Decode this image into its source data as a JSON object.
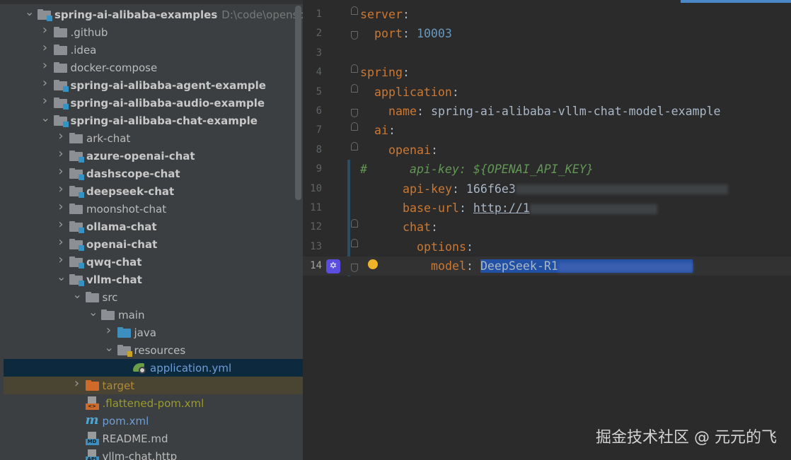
{
  "project_tree": {
    "root_path": "D:\\code\\opensource\\",
    "items": [
      {
        "label": "spring-ai-alibaba-examples",
        "level": 0,
        "expand": "open",
        "icon": "module-folder",
        "bold": true
      },
      {
        "label": ".github",
        "level": 1,
        "expand": "closed",
        "icon": "folder"
      },
      {
        "label": ".idea",
        "level": 1,
        "expand": "closed",
        "icon": "folder"
      },
      {
        "label": "docker-compose",
        "level": 1,
        "expand": "closed",
        "icon": "folder"
      },
      {
        "label": "spring-ai-alibaba-agent-example",
        "level": 1,
        "expand": "closed",
        "icon": "module-folder",
        "bold": true
      },
      {
        "label": "spring-ai-alibaba-audio-example",
        "level": 1,
        "expand": "closed",
        "icon": "module-folder",
        "bold": true
      },
      {
        "label": "spring-ai-alibaba-chat-example",
        "level": 1,
        "expand": "open",
        "icon": "module-folder",
        "bold": true
      },
      {
        "label": "ark-chat",
        "level": 2,
        "expand": "closed",
        "icon": "folder"
      },
      {
        "label": "azure-openai-chat",
        "level": 2,
        "expand": "closed",
        "icon": "module-folder",
        "bold": true
      },
      {
        "label": "dashscope-chat",
        "level": 2,
        "expand": "closed",
        "icon": "module-folder",
        "bold": true
      },
      {
        "label": "deepseek-chat",
        "level": 2,
        "expand": "closed",
        "icon": "module-folder",
        "bold": true
      },
      {
        "label": "moonshot-chat",
        "level": 2,
        "expand": "closed",
        "icon": "folder"
      },
      {
        "label": "ollama-chat",
        "level": 2,
        "expand": "closed",
        "icon": "module-folder",
        "bold": true
      },
      {
        "label": "openai-chat",
        "level": 2,
        "expand": "closed",
        "icon": "module-folder",
        "bold": true
      },
      {
        "label": "qwq-chat",
        "level": 2,
        "expand": "closed",
        "icon": "module-folder",
        "bold": true
      },
      {
        "label": "vllm-chat",
        "level": 2,
        "expand": "open",
        "icon": "module-folder",
        "bold": true
      },
      {
        "label": "src",
        "level": 3,
        "expand": "open",
        "icon": "folder"
      },
      {
        "label": "main",
        "level": 4,
        "expand": "open",
        "icon": "folder"
      },
      {
        "label": "java",
        "level": 5,
        "expand": "closed",
        "icon": "source-folder"
      },
      {
        "label": "resources",
        "level": 5,
        "expand": "open",
        "icon": "resources-folder"
      },
      {
        "label": "application.yml",
        "level": 6,
        "expand": "none",
        "icon": "spring-yml",
        "state": "selected",
        "color": "#6e9ed6"
      },
      {
        "label": "target",
        "level": 3,
        "expand": "closed",
        "icon": "excluded-folder",
        "state": "excluded",
        "color": "#b08a3a"
      },
      {
        "label": ".flattened-pom.xml",
        "level": 3,
        "expand": "none",
        "icon": "xml-file",
        "color": "#9a9a2e"
      },
      {
        "label": "pom.xml",
        "level": 3,
        "expand": "none",
        "icon": "maven-file",
        "color": "#6e9ed6"
      },
      {
        "label": "README.md",
        "level": 3,
        "expand": "none",
        "icon": "md-file"
      },
      {
        "label": "vllm-chat.http",
        "level": 3,
        "expand": "none",
        "icon": "http-file"
      }
    ]
  },
  "editor": {
    "lines": [
      {
        "num": "1",
        "indent": 0,
        "tokens": [
          [
            "k",
            "server"
          ],
          [
            "",
            ""
          ],
          [
            "",
            ":"
          ]
        ],
        "fold": "up"
      },
      {
        "num": "2",
        "indent": 1,
        "tokens": [
          [
            "k",
            "port"
          ],
          [
            "",
            ": "
          ],
          [
            "n",
            "10003"
          ]
        ],
        "fold": "down"
      },
      {
        "num": "3",
        "indent": 0,
        "tokens": []
      },
      {
        "num": "4",
        "indent": 0,
        "tokens": [
          [
            "k",
            "spring"
          ],
          [
            "",
            ":"
          ]
        ],
        "fold": "up"
      },
      {
        "num": "5",
        "indent": 1,
        "tokens": [
          [
            "k",
            "application"
          ],
          [
            "",
            ":"
          ]
        ],
        "fold": "up"
      },
      {
        "num": "6",
        "indent": 2,
        "tokens": [
          [
            "k",
            "name"
          ],
          [
            "",
            ": spring-ai-alibaba-vllm-chat-model-example"
          ]
        ],
        "fold": "down"
      },
      {
        "num": "7",
        "indent": 1,
        "tokens": [
          [
            "k",
            "ai"
          ],
          [
            "",
            ":"
          ]
        ],
        "fold": "up"
      },
      {
        "num": "8",
        "indent": 2,
        "tokens": [
          [
            "k",
            "openai"
          ],
          [
            "",
            ":"
          ]
        ],
        "fold": "up"
      },
      {
        "num": "9",
        "indent": 0,
        "tokens": [
          [
            "c",
            "#      api-key: ${OPENAI_API_KEY}"
          ]
        ]
      },
      {
        "num": "10",
        "indent": 3,
        "tokens": [
          [
            "k",
            "api-key"
          ],
          [
            "",
            ": 166f6e3"
          ],
          [
            "blur",
            "30"
          ]
        ]
      },
      {
        "num": "11",
        "indent": 3,
        "tokens": [
          [
            "k",
            "base-url"
          ],
          [
            "",
            ": "
          ],
          [
            "u",
            "http://1"
          ],
          [
            "blur",
            "18"
          ]
        ]
      },
      {
        "num": "12",
        "indent": 3,
        "tokens": [
          [
            "k",
            "chat"
          ],
          [
            "",
            ":"
          ]
        ],
        "fold": "up"
      },
      {
        "num": "13",
        "indent": 4,
        "tokens": [
          [
            "k",
            "options"
          ],
          [
            "",
            ":"
          ]
        ],
        "fold": "up"
      },
      {
        "num": "14",
        "indent": 5,
        "tokens": [
          [
            "k",
            "model"
          ],
          [
            "",
            ": "
          ],
          [
            "sel",
            "DeepSeek-R1"
          ],
          [
            "selblur",
            "19"
          ]
        ],
        "fold": "down",
        "current": true
      }
    ]
  },
  "watermark": "掘金技术社区 @ 元元的飞"
}
